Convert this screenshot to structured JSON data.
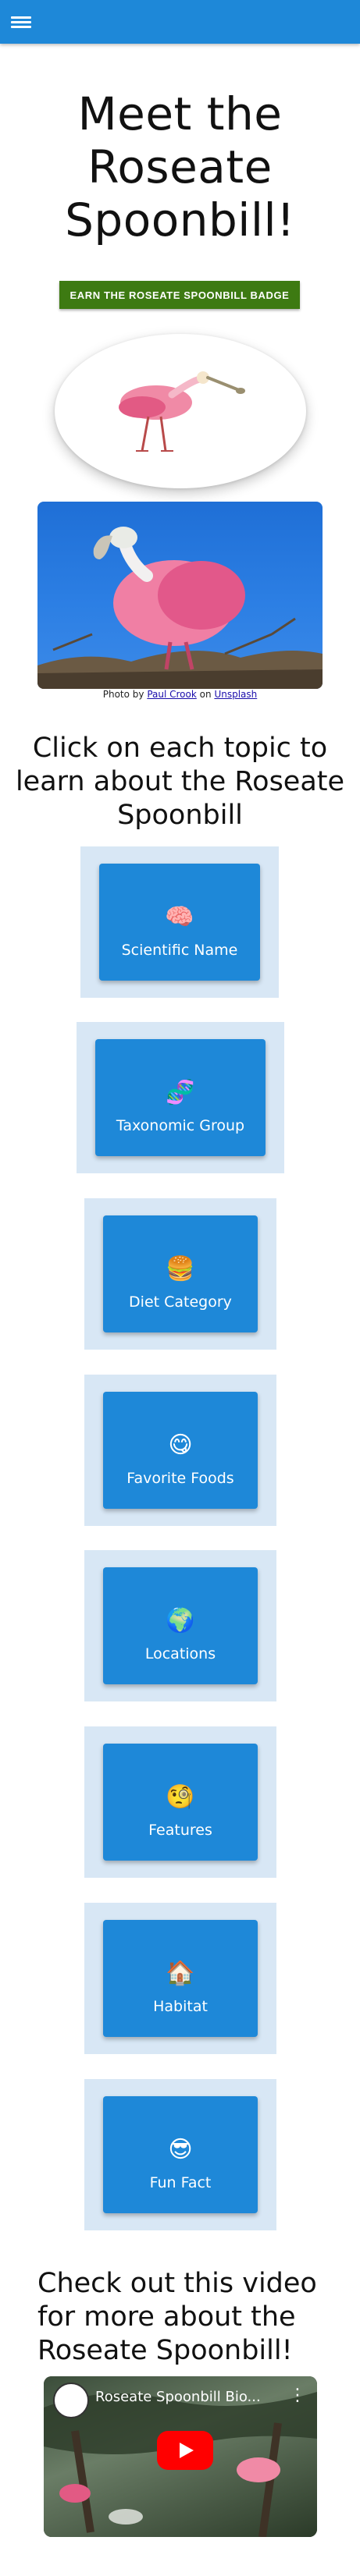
{
  "header": {
    "menu_icon": "hamburger-menu-icon"
  },
  "title": "Meet the Roseate Spoonbill!",
  "badge_button": "EARN THE ROSEATE SPOONBILL BADGE",
  "photo_credit": {
    "prefix": "Photo by",
    "author": "Paul Crook",
    "middle": "on",
    "site": "Unsplash"
  },
  "topics_heading": "Click on each topic to learn about the Roseate Spoonbill",
  "topics": [
    {
      "emoji": "🧠",
      "label": "Scientific Name",
      "icon": "brain-icon"
    },
    {
      "emoji": "🧬",
      "label": "Taxonomic Group",
      "icon": "dna-icon"
    },
    {
      "emoji": "🍔",
      "label": "Diet Category",
      "icon": "hamburger-icon"
    },
    {
      "emoji": "😋",
      "label": "Favorite Foods",
      "icon": "yum-face-icon"
    },
    {
      "emoji": "🌍",
      "label": "Locations",
      "icon": "globe-icon"
    },
    {
      "emoji": "🧐",
      "label": "Features",
      "icon": "monocle-face-icon"
    },
    {
      "emoji": "🏠",
      "label": "Habitat",
      "icon": "house-icon"
    },
    {
      "emoji": "😎",
      "label": "Fun Fact",
      "icon": "sunglasses-face-icon"
    }
  ],
  "video_heading": "Check out this video for more about the Roseate Spoonbill!",
  "video": {
    "title": "Roseate Spoonbill Bio..."
  }
}
